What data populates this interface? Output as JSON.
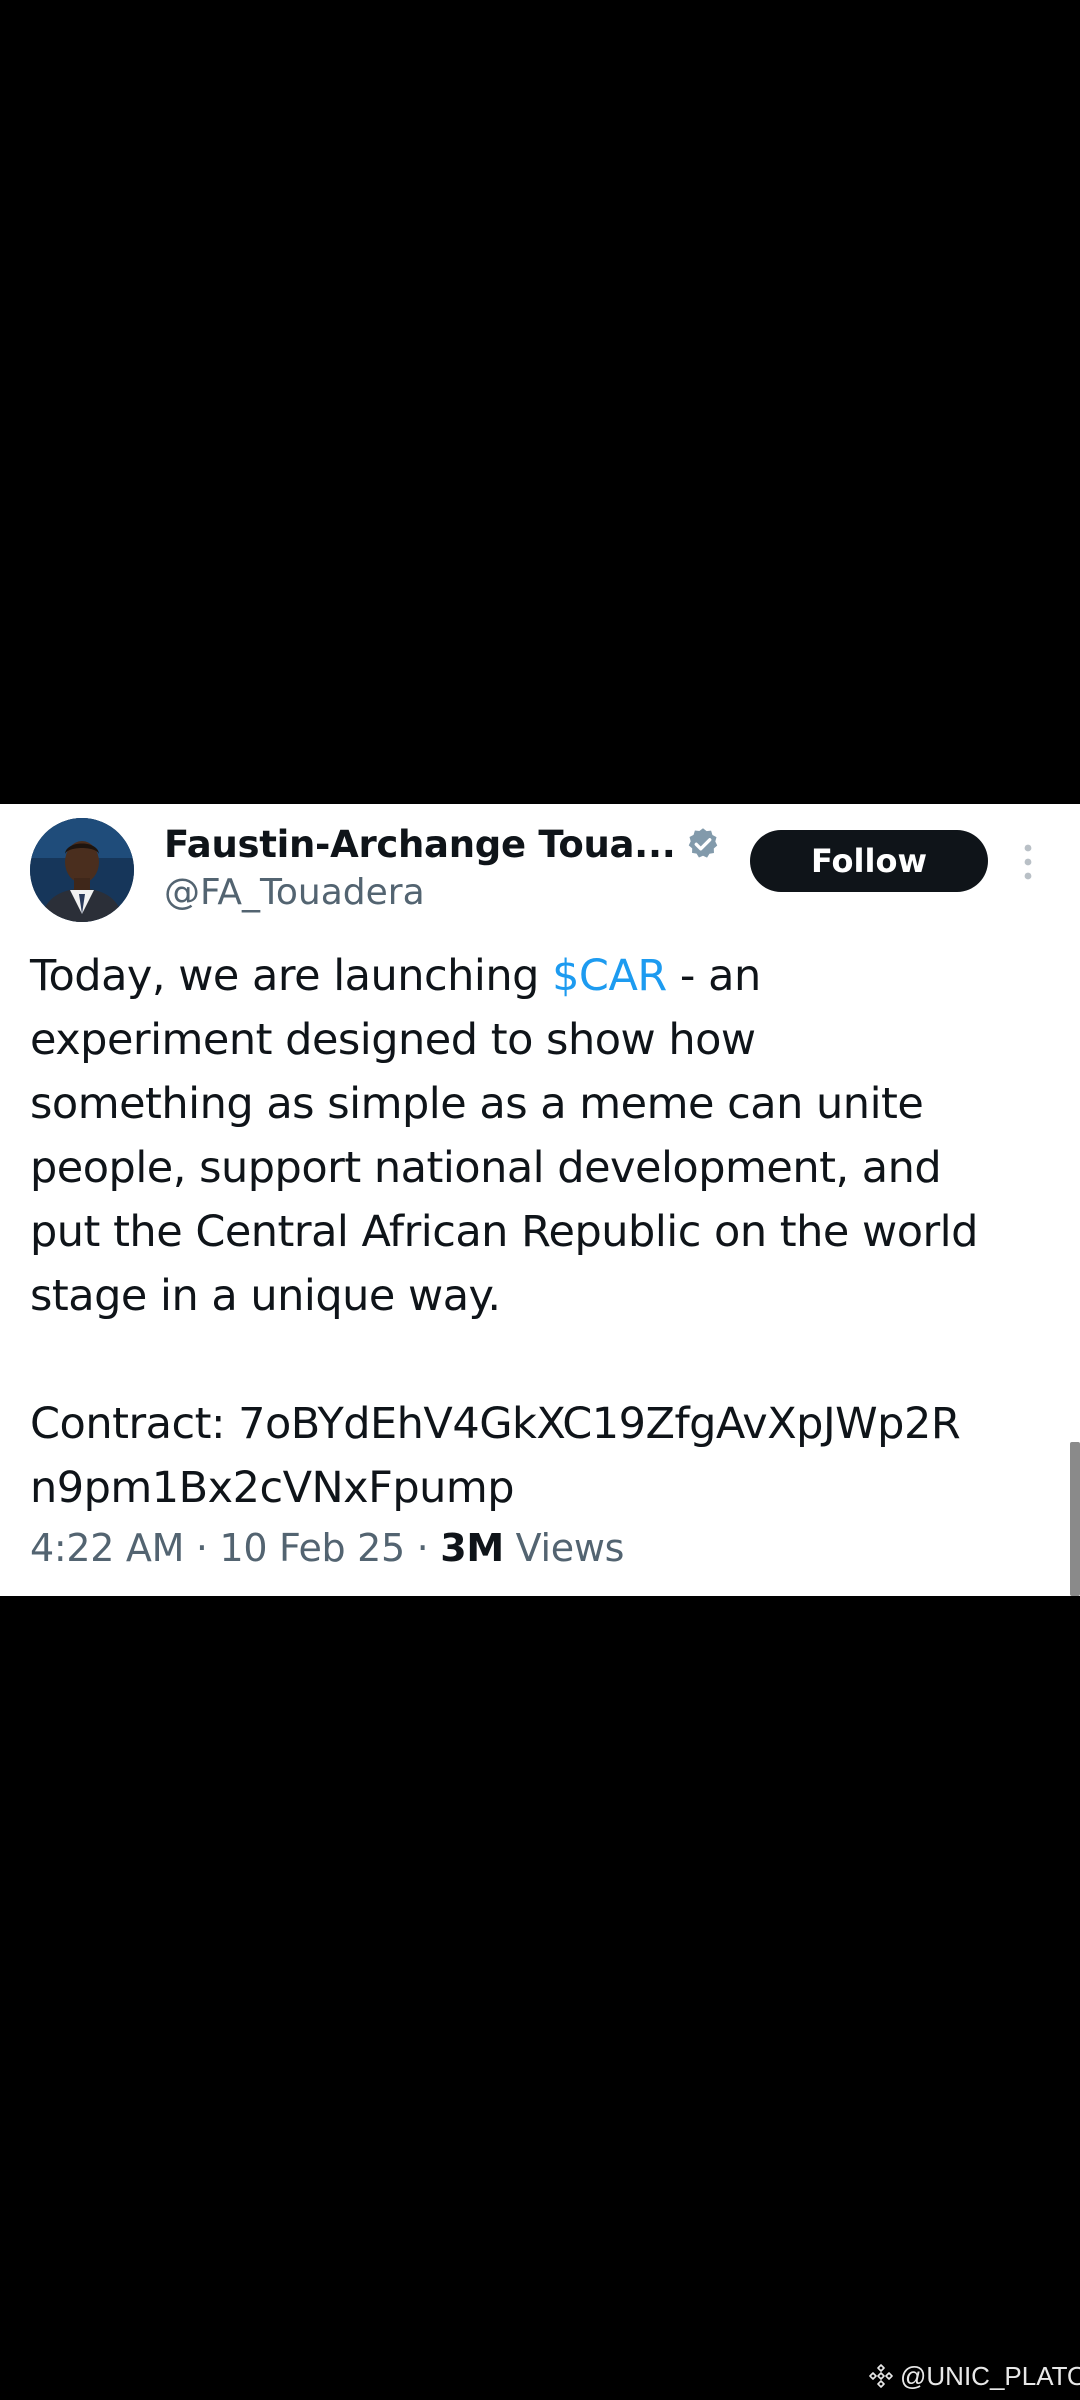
{
  "tweet": {
    "author": {
      "display_name": "Faustin-Archange Toua...",
      "handle": "@FA_Touadera",
      "verified_icon": "verified-badge-icon",
      "verified_color": "#829aab"
    },
    "follow_label": "Follow",
    "more_icon": "more-vertical-icon",
    "text": {
      "line1_before": "Today, we are launching ",
      "cashtag": "$CAR",
      "line1_after": " - an",
      "line2": "experiment designed to show how",
      "line3": "something as simple as a meme can unite",
      "line4": "people, support national development, and",
      "line5": "put the Central African Republic on the world",
      "line6": "stage in a unique way.",
      "contract_line1": "Contract: 7oBYdEhV4GkXC19ZfgAvXpJWp2R",
      "contract_line2": "n9pm1Bx2cVNxFpump"
    },
    "meta": {
      "time": "4:22 AM",
      "separator1": " · ",
      "date": "10 Feb 25",
      "separator2": " · ",
      "views_count": "3M",
      "views_label": " Views"
    }
  },
  "watermark": {
    "text": "@UNIC_PLATO",
    "icon": "diamond-logo-icon"
  },
  "colors": {
    "background": "#000000",
    "card": "#ffffff",
    "text_primary": "#0f1419",
    "text_secondary": "#536471",
    "link": "#1d9bf0",
    "follow_button_bg": "#0f1419"
  }
}
